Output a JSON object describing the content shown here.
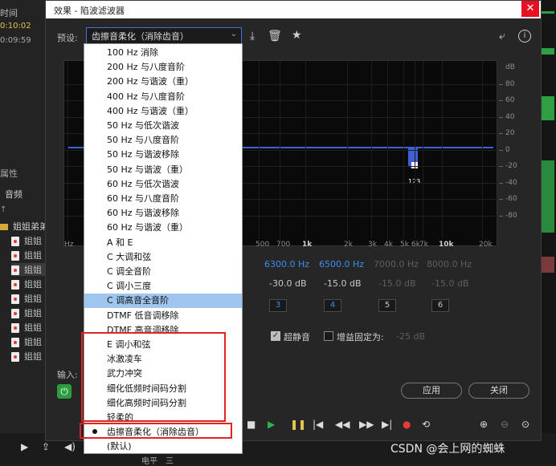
{
  "background": {
    "time_header": "时间",
    "time_1": "0:10:02",
    "time_2": "0:09:59",
    "attr": "属性",
    "audio": "音频",
    "up_arrow": "↑",
    "folder": "姐姐弟弟",
    "file_label": "姐姐",
    "file_count": 9,
    "bottom_text_1": "电平",
    "bottom_text_2": "三"
  },
  "dialog": {
    "title": "效果 - 陷波滤波器",
    "close_glyph": "✕",
    "preset_label": "预设:",
    "preset_value": "齿擦音柔化（消除齿音）",
    "icons": {
      "save": "download-icon",
      "delete": "trash-icon",
      "favorite": "star-icon",
      "route": "route-icon",
      "info": "info-icon"
    }
  },
  "graph": {
    "y_labels": [
      "dB",
      "80",
      "60",
      "40",
      "20",
      "0",
      "-20",
      "-40",
      "-60",
      "-80"
    ],
    "x_labels": [
      "Hz",
      "500",
      "700",
      "1k",
      "2k",
      "3k",
      "4k",
      "5k",
      "6k",
      "7k",
      "10k",
      "20k"
    ],
    "notch_label": "123",
    "flat_level_db": 0
  },
  "bands": [
    {
      "id": "1",
      "freq": "",
      "gain": "",
      "enabled": true
    },
    {
      "id": "2",
      "freq": "Hz",
      "gain": "dB",
      "enabled": true
    },
    {
      "id": "3",
      "freq": "6300.0 Hz",
      "gain": "-30.0 dB",
      "enabled": true
    },
    {
      "id": "4",
      "freq": "6500.0 Hz",
      "gain": "-15.0 dB",
      "enabled": true
    },
    {
      "id": "5",
      "freq": "7000.0 Hz",
      "gain": "-15.0 dB",
      "enabled": false
    },
    {
      "id": "6",
      "freq": "8000.0 Hz",
      "gain": "-15.0 dB",
      "enabled": false
    }
  ],
  "options": {
    "super_mute_label": "超静音",
    "super_mute_checked": true,
    "fixed_gain_label": "增益固定为:",
    "fixed_gain_checked": false,
    "fixed_gain_value": "-25 dB"
  },
  "footer": {
    "input_label": "输入:",
    "apply_label": "应用",
    "close_label": "关闭"
  },
  "dropdown": {
    "items": [
      "100 Hz 消除",
      "200 Hz 与八度音阶",
      "200 Hz 与谐波（重）",
      "400 Hz 与八度音阶",
      "400 Hz 与谐波（重）",
      "50 Hz 与低次谐波",
      "50 Hz 与八度音阶",
      "50 Hz 与谐波移除",
      "50 Hz 与谐波（重）",
      "60 Hz 与低次谐波",
      "60 Hz 与八度音阶",
      "60 Hz 与谐波移除",
      "60 Hz 与谐波（重）",
      "A 和 E",
      "C 大调和弦",
      "C 调全音阶",
      "C 调小三度",
      "C 调高音全音阶",
      "DTMF 低音调移除",
      "DTMF 高音调移除",
      "E 调小和弦",
      "冰激凌车",
      "武力冲突",
      "细化低频时间码分割",
      "细化高频时间码分割",
      "轻柔的",
      "齿擦音柔化（消除齿音）",
      "(默认)"
    ],
    "highlighted": "C 调高音全音阶",
    "checked": "齿擦音柔化（消除齿音）"
  },
  "watermark": "CSDN @会上网的蜘蛛",
  "colors": {
    "accent": "#3b8ef0",
    "curve": "#3d5fd8",
    "close": "#e81123",
    "power": "#2b9d3f",
    "highlight_box": "#e02424",
    "selection": "#9ec6ee"
  }
}
